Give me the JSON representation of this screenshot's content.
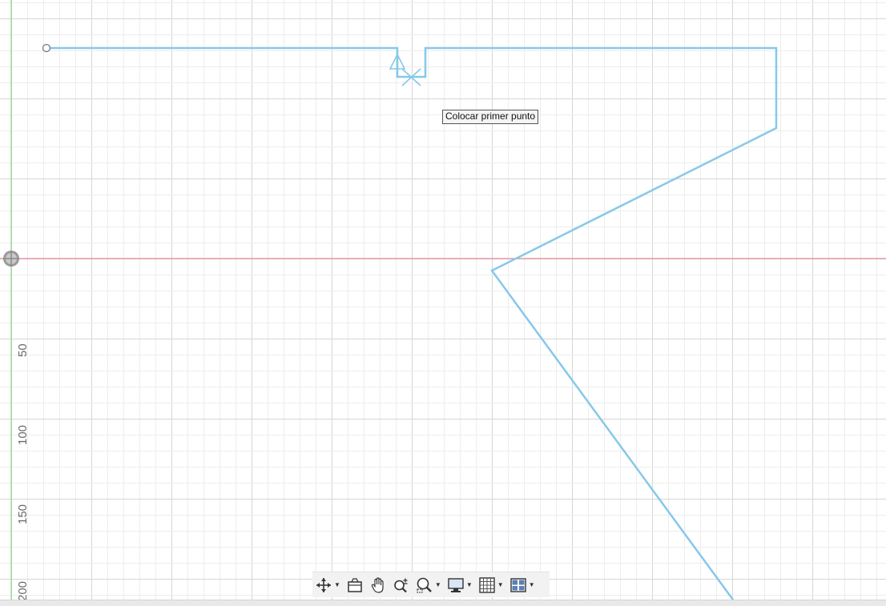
{
  "canvas": {
    "tooltip": "Colocar primer punto",
    "y_axis_labels": [
      "50",
      "100",
      "150",
      "200"
    ],
    "colors": {
      "profile_stroke": "#86c9e8",
      "x_axis": "#e8899a",
      "y_axis": "#8fd48f",
      "grid_minor": "#ededed",
      "grid_major": "#d6d6d6"
    }
  },
  "toolbar": {
    "items": [
      {
        "name": "orbit-icon",
        "has_dropdown": true
      },
      {
        "name": "look-at-icon",
        "has_dropdown": false
      },
      {
        "name": "pan-hand-icon",
        "has_dropdown": false
      },
      {
        "name": "zoom-icon",
        "has_dropdown": false
      },
      {
        "name": "fit-window-icon",
        "has_dropdown": true
      },
      {
        "name": "display-settings-icon",
        "has_dropdown": true
      },
      {
        "name": "grid-snaps-icon",
        "has_dropdown": true
      },
      {
        "name": "viewports-icon",
        "has_dropdown": true
      }
    ]
  }
}
